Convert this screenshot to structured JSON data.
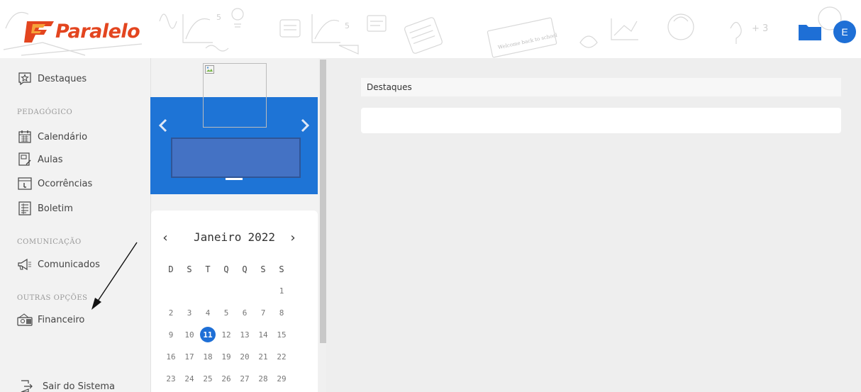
{
  "brand": {
    "name": "Paralelo",
    "logo_color": "#e3451f"
  },
  "header": {
    "folder_icon": "folder-icon",
    "avatar_initial": "E",
    "accent_color": "#1e6fd6"
  },
  "sidebar": {
    "items_top": [
      {
        "label": "Destaques",
        "icon": "star-speech-icon"
      }
    ],
    "sections": [
      {
        "title": "PEDAGÓGICO",
        "items": [
          {
            "label": "Calendário",
            "icon": "calendar-icon"
          },
          {
            "label": "Aulas",
            "icon": "lesson-icon"
          },
          {
            "label": "Ocorrências",
            "icon": "occurrence-icon"
          },
          {
            "label": "Boletim",
            "icon": "report-card-icon"
          }
        ]
      },
      {
        "title": "COMUNICAÇÃO",
        "items": [
          {
            "label": "Comunicados",
            "icon": "megaphone-icon"
          }
        ]
      },
      {
        "title": "OUTRAS OPÇÕES",
        "items": [
          {
            "label": "Financeiro",
            "icon": "wallet-icon"
          }
        ]
      }
    ],
    "logout": {
      "label": "Sair do Sistema",
      "icon": "logout-icon"
    }
  },
  "carousel": {
    "color": "#1e74d6"
  },
  "calendar": {
    "month": "Janeiro",
    "year": "2022",
    "weekdays": [
      "D",
      "S",
      "T",
      "Q",
      "Q",
      "S",
      "S"
    ],
    "selected_day": "11",
    "weeks": [
      [
        "",
        "",
        "",
        "",
        "",
        "",
        "1"
      ],
      [
        "2",
        "3",
        "4",
        "5",
        "6",
        "7",
        "8"
      ],
      [
        "9",
        "10",
        "11",
        "12",
        "13",
        "14",
        "15"
      ],
      [
        "16",
        "17",
        "18",
        "19",
        "20",
        "21",
        "22"
      ],
      [
        "23",
        "24",
        "25",
        "26",
        "27",
        "28",
        "29"
      ]
    ]
  },
  "main": {
    "title": "Destaques"
  }
}
